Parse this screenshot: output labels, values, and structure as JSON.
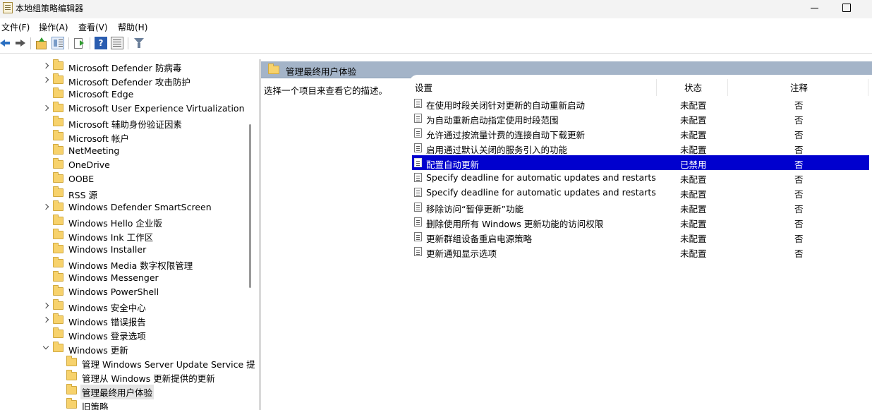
{
  "window": {
    "title": "本地组策略编辑器"
  },
  "menu": [
    "文件(F)",
    "操作(A)",
    "查看(V)",
    "帮助(H)"
  ],
  "toolbar_icons": [
    "back-arrow-icon",
    "forward-arrow-icon",
    "up-folder-icon",
    "show-tree-icon",
    "export-list-icon",
    "help-icon",
    "properties-icon",
    "filter-icon"
  ],
  "toolbar": {
    "help_glyph": "?"
  },
  "tree": [
    {
      "label": "Microsoft Defender 防病毒",
      "expander": "collapsed",
      "level": 0
    },
    {
      "label": "Microsoft Defender 攻击防护",
      "expander": "collapsed",
      "level": 0
    },
    {
      "label": "Microsoft Edge",
      "expander": "none",
      "level": 0
    },
    {
      "label": "Microsoft User Experience Virtualization",
      "expander": "collapsed",
      "level": 0
    },
    {
      "label": "Microsoft 辅助身份验证因素",
      "expander": "none",
      "level": 0
    },
    {
      "label": "Microsoft 帐户",
      "expander": "none",
      "level": 0
    },
    {
      "label": "NetMeeting",
      "expander": "none",
      "level": 0
    },
    {
      "label": "OneDrive",
      "expander": "none",
      "level": 0
    },
    {
      "label": "OOBE",
      "expander": "none",
      "level": 0
    },
    {
      "label": "RSS 源",
      "expander": "none",
      "level": 0
    },
    {
      "label": "Windows Defender SmartScreen",
      "expander": "collapsed",
      "level": 0
    },
    {
      "label": "Windows Hello 企业版",
      "expander": "none",
      "level": 0
    },
    {
      "label": "Windows Ink 工作区",
      "expander": "none",
      "level": 0
    },
    {
      "label": "Windows Installer",
      "expander": "none",
      "level": 0
    },
    {
      "label": "Windows Media 数字权限管理",
      "expander": "none",
      "level": 0
    },
    {
      "label": "Windows Messenger",
      "expander": "none",
      "level": 0
    },
    {
      "label": "Windows PowerShell",
      "expander": "none",
      "level": 0
    },
    {
      "label": "Windows 安全中心",
      "expander": "collapsed",
      "level": 0
    },
    {
      "label": "Windows 错误报告",
      "expander": "collapsed",
      "level": 0
    },
    {
      "label": "Windows 登录选项",
      "expander": "none",
      "level": 0
    },
    {
      "label": "Windows 更新",
      "expander": "expanded",
      "level": 0
    },
    {
      "label": "管理 Windows Server Update Service 提",
      "expander": "none",
      "level": 1
    },
    {
      "label": "管理从 Windows 更新提供的更新",
      "expander": "none",
      "level": 1
    },
    {
      "label": "管理最终用户体验",
      "expander": "none",
      "level": 1,
      "selected": true
    },
    {
      "label": "旧策略",
      "expander": "none",
      "level": 1
    }
  ],
  "right_pane": {
    "header_title": "管理最终用户体验",
    "description": "选择一个项目来查看它的描述。",
    "columns": {
      "setting": "设置",
      "state": "状态",
      "comment": "注释"
    },
    "rows": [
      {
        "name": "在使用时段关闭针对更新的自动重新启动",
        "state": "未配置",
        "comment": "否"
      },
      {
        "name": "为自动重新启动指定使用时段范围",
        "state": "未配置",
        "comment": "否"
      },
      {
        "name": "允许通过按流量计费的连接自动下载更新",
        "state": "未配置",
        "comment": "否"
      },
      {
        "name": "启用通过默认关闭的服务引入的功能",
        "state": "未配置",
        "comment": "否"
      },
      {
        "name": "配置自动更新",
        "state": "已禁用",
        "comment": "否",
        "selected": true
      },
      {
        "name": "Specify deadline for automatic updates and restarts f...",
        "state": "未配置",
        "comment": "否"
      },
      {
        "name": "Specify deadline for automatic updates and restarts f...",
        "state": "未配置",
        "comment": "否"
      },
      {
        "name": "移除访问“暂停更新”功能",
        "state": "未配置",
        "comment": "否"
      },
      {
        "name": "删除使用所有 Windows 更新功能的访问权限",
        "state": "未配置",
        "comment": "否"
      },
      {
        "name": "更新群组设备重启电源策略",
        "state": "未配置",
        "comment": "否"
      },
      {
        "name": "更新通知显示选项",
        "state": "未配置",
        "comment": "否"
      }
    ]
  },
  "colors": {
    "selection": "#0000ce",
    "pane_header": "#a4b4c8",
    "folder": "#f7d26c"
  }
}
